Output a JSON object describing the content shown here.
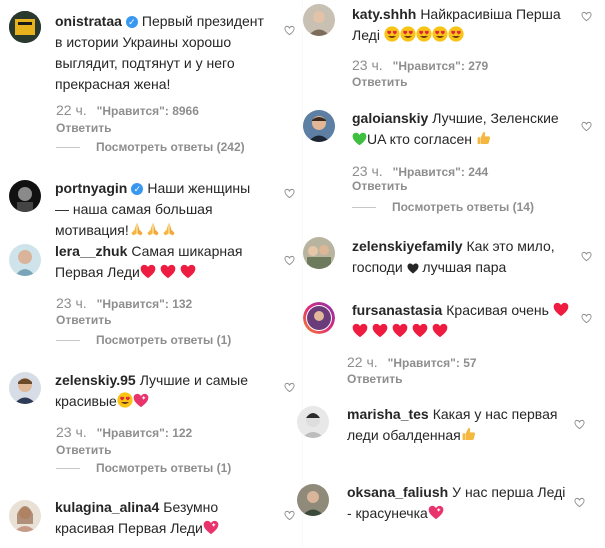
{
  "reply_label": "Ответить",
  "likes_prefix": "\"Нравится\": ",
  "left": [
    {
      "user": "onistrataa",
      "verified": true,
      "lines": [
        "Первый президент",
        "в истории Украины хорошо",
        "выглядит, подтянут и у него",
        "прекрасная жена!"
      ],
      "time": "22 ч.",
      "likes": "8966",
      "view_replies": "Посмотреть ответы (242)"
    },
    {
      "user": "portnyagin",
      "verified": true,
      "lines": [
        "Наши женщины",
        "— наша самая большая",
        "мотивация!"
      ],
      "emoji_tail": "🙏🙏🙏"
    },
    {
      "user": "lera__zhuk",
      "lines": [
        "Самая шикарная",
        "Первая Леди"
      ],
      "time": "23 ч.",
      "likes": "132",
      "view_replies": "Посмотреть ответы (1)"
    },
    {
      "user": "zelenskiy.95",
      "lines": [
        "Лучшие и самые",
        "красивые"
      ],
      "time": "23 ч.",
      "likes": "122",
      "view_replies": "Посмотреть ответы (1)"
    },
    {
      "user": "kulagina_alina4",
      "lines": [
        "Безумно",
        "красивая Первая Леди"
      ]
    }
  ],
  "right": [
    {
      "user": "katy.shhh",
      "lines": [
        "Найкрасивіша Перша",
        "Леді"
      ],
      "time": "23 ч.",
      "likes": "279"
    },
    {
      "user": "galoianskiy",
      "lines": [
        "Лучшие, Зеленские",
        "UA кто согласен"
      ],
      "time": "23 ч.",
      "likes": "244",
      "view_replies": "Посмотреть ответы (14)"
    },
    {
      "user": "zelenskiyefamily",
      "lines": [
        "Как это мило,",
        "господи",
        "лучшая пара"
      ]
    },
    {
      "user": "fursanastasia",
      "lines": [
        "Красивая очень"
      ],
      "time": "22 ч.",
      "likes": "57"
    },
    {
      "user": "marisha_tes",
      "lines": [
        "Какая у нас первая",
        "леди обалденная"
      ]
    },
    {
      "user": "oksana_faliush",
      "lines": [
        "У нас перша Леді",
        "- красунечка"
      ]
    }
  ],
  "colors": {
    "heart_red": "#ed1c40",
    "text": "#262626",
    "muted": "#8e8e8e",
    "verified": "#3897f0"
  }
}
